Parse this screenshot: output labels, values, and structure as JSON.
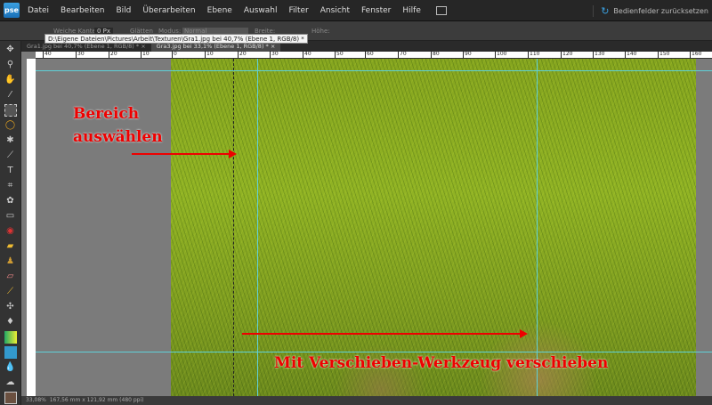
{
  "app": {
    "logo": "pse"
  },
  "menu": [
    "Datei",
    "Bearbeiten",
    "Bild",
    "Überarbeiten",
    "Ebene",
    "Auswahl",
    "Filter",
    "Ansicht",
    "Fenster",
    "Hilfe"
  ],
  "reset_panels": "Bedienfelder zurücksetzen",
  "options": {
    "feather_label": "Weiche Kante:",
    "feather_value": "0 Px",
    "antialias": "Glätten",
    "mode_label": "Modus:",
    "mode_value": "Normal",
    "width": "Breite:",
    "height": "Höhe:"
  },
  "tooltip": "D:\\Eigene Dateien\\Pictures\\Arbeit\\Texturen\\Gra1.jpg bei 40,7% (Ebene 1, RGB/8) *",
  "tabs": [
    {
      "label": "Gra1.jpg bei 40,7% (Ebene 1, RGB/8) *"
    },
    {
      "label": "Gra3.jpg bei 33,1% (Ebene 1, RGB/8) *"
    }
  ],
  "ruler": [
    "40",
    "30",
    "20",
    "10",
    "0",
    "10",
    "20",
    "30",
    "40",
    "50",
    "60",
    "70",
    "80",
    "90",
    "100",
    "110",
    "120",
    "130",
    "140",
    "150",
    "160"
  ],
  "annotations": {
    "select_line1": "Bereich",
    "select_line2": "auswählen",
    "move": "Mit Verschieben-Werkzeug verschieben"
  },
  "status": {
    "zoom": "33,08%",
    "size": "167,56 mm x 121,92 mm (480 ppi)"
  }
}
